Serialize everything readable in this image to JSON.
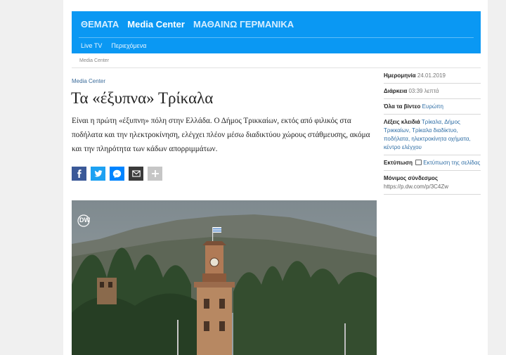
{
  "nav": {
    "main": [
      "ΘΕΜΑΤΑ",
      "Media Center",
      "ΜΑΘΑΙΝΩ ΓΕΡΜΑΝΙΚΑ"
    ],
    "sub": [
      "Live TV",
      "Περιεχόμενα"
    ]
  },
  "breadcrumb": "Media Center",
  "article": {
    "kicker": "Media Center",
    "title": "Τα «έξυπνα» Τρίκαλα",
    "lead": "Είναι η πρώτη «έξυπνη» πόλη στην Ελλάδα. Ο Δήμος Τρικκαίων, εκτός από φιλικός στα ποδήλατα και την ηλεκτροκίνηση, ελέγχει πλέον μέσω διαδικτύου χώρους στάθμευσης, ακόμα και την πληρότητα των κάδων απορριμμάτων."
  },
  "share_icons": [
    "facebook-icon",
    "twitter-icon",
    "messenger-icon",
    "email-icon",
    "plus-icon"
  ],
  "video": {
    "logo": "DW"
  },
  "sidebar": {
    "date_label": "Ημερομηνία",
    "date_value": "24.01.2019",
    "duration_label": "Διάρκεια",
    "duration_value": "03:39 λεπτά",
    "all_videos_label": "Όλα τα βίντεο",
    "all_videos_value": "Ευρώπη",
    "keywords_label": "Λέξεις κλειδιά",
    "keywords": [
      "Τρίκαλα",
      "Δήμος Τρικκαίων",
      "Τρίκαλα διαδίκτυο",
      "ποδήλατα",
      "ηλεκτροκίνητα οχήματα",
      "κέντρο ελέγχου"
    ],
    "print_label": "Εκτύπωση",
    "print_link": "Εκτύπωση της σελίδας",
    "permalink_label": "Μόνιμος σύνδεσμος",
    "permalink_url": "https://p.dw.com/p/3C4Zw"
  },
  "colors": {
    "nav_bg": "#0a98f3",
    "link": "#2f6ea5",
    "facebook": "#3b5998",
    "twitter": "#1da1f2",
    "messenger": "#0084ff"
  }
}
